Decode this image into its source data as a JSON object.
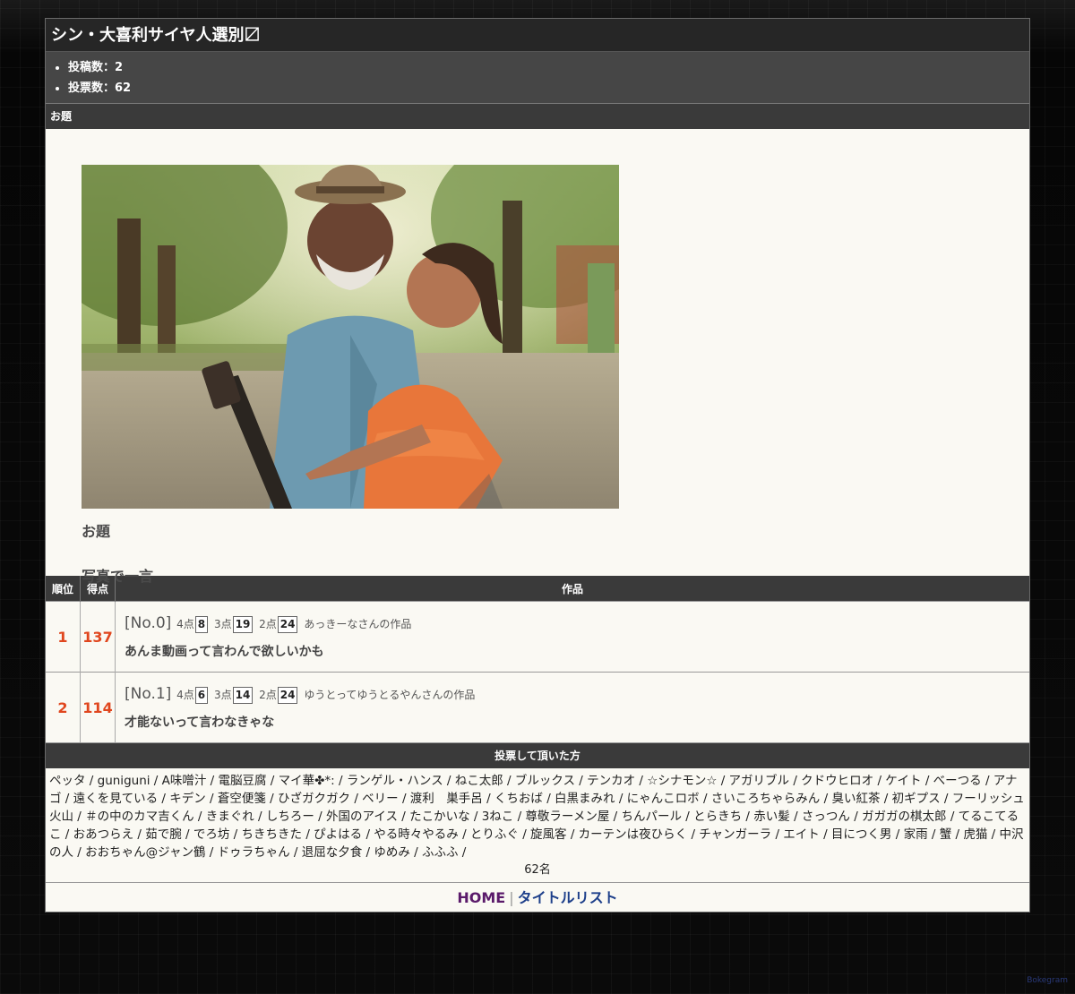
{
  "header": {
    "title": "シン・大喜利サイヤ人選別〼"
  },
  "stats": {
    "posts": "投稿数：2",
    "votes": "投票数：62"
  },
  "topic": {
    "section_label": "お題",
    "heading": "お題",
    "text": "写真で一言"
  },
  "ranking": {
    "col_rank": "順位",
    "col_score": "得点",
    "col_work": "作品",
    "rows": [
      {
        "rank": "1",
        "score": "137",
        "no": "[No.0]",
        "l4": "4点",
        "v4": "8",
        "l3": "3点",
        "v3": "19",
        "l2": "2点",
        "v2": "24",
        "author": "あっきーなさんの作品",
        "text": "あんま動画って言わんで欲しいかも"
      },
      {
        "rank": "2",
        "score": "114",
        "no": "[No.1]",
        "l4": "4点",
        "v4": "6",
        "l3": "3点",
        "v3": "14",
        "l2": "2点",
        "v2": "24",
        "author": "ゆうとってゆうとるやんさんの作品",
        "text": "才能ないって言わなきゃな"
      }
    ]
  },
  "voters": {
    "label": "投票して頂いた方",
    "list": "ペッタ / guniguni / A味噌汁 / 電脳豆腐 / マイ華✤*: / ランゲル・ハンス / ねこ太郎 / ブルックス / テンカオ / ☆シナモン☆ / アガリブル / クドウヒロオ / ケイト / べーつる / アナゴ / 遠くを見ている / キデン / 蒼空便箋 / ひざガクガク / ベリー / 渡利　巣手呂 / くちおば / 白黒まみれ / にゃんこロボ / さいころちゃらみん / 臭い紅茶 / 初ギプス / フーリッシュ火山 / ＃の中のカマ吉くん / きまぐれ / しちろー / 外国のアイス / たこかいな / 3ねこ / 尊敬ラーメン屋 / ちんパール / とらきち / 赤い髪 / さっつん / ガガガの棋太郎 / てるこてるこ / おあつらえ / 茹で腕 / でろ坊 / ちきちきた / ぴよはる / やる時々やるみ / とりふぐ / 旋風客 / カーテンは夜ひらく / チャンガーラ / エイト / 目につく男 / 家雨 / 蟹 / 虎猫 / 中沢の人 / おおちゃん@ジャン鶴 / ドゥラちゃん / 退屈な夕食 / ゆめみ / ふふふ /",
    "count": "62名"
  },
  "nav": {
    "home": "HOME",
    "sep": "|",
    "title_list": "タイトルリスト"
  },
  "brand": "Bokegram"
}
